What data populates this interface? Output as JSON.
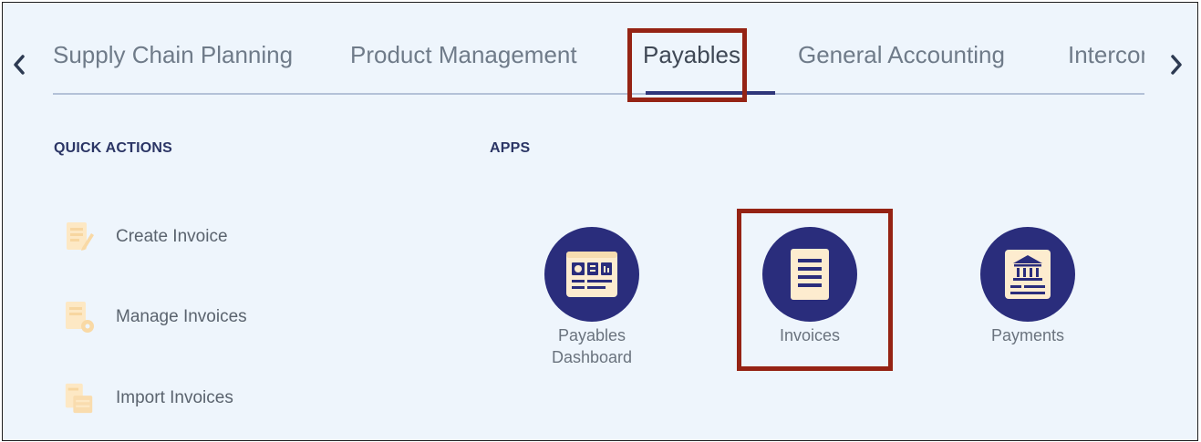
{
  "tabs": [
    {
      "label": "Supply Chain Planning",
      "active": false
    },
    {
      "label": "Product Management",
      "active": false
    },
    {
      "label": "Payables",
      "active": true
    },
    {
      "label": "General Accounting",
      "active": false
    },
    {
      "label": "Intercompany",
      "active": false
    }
  ],
  "nav": {
    "prev_icon": "chevron-left-icon",
    "next_icon": "chevron-right-icon"
  },
  "quick_actions": {
    "heading": "QUICK ACTIONS",
    "items": [
      {
        "label": "Create Invoice",
        "icon": "create-invoice-icon"
      },
      {
        "label": "Manage Invoices",
        "icon": "manage-invoices-icon"
      },
      {
        "label": "Import Invoices",
        "icon": "import-invoices-icon"
      }
    ]
  },
  "apps": {
    "heading": "APPS",
    "items": [
      {
        "label": "Payables\nDashboard",
        "icon": "dashboard-icon"
      },
      {
        "label": "Invoices",
        "icon": "invoice-document-icon"
      },
      {
        "label": "Payments",
        "icon": "bank-icon"
      }
    ]
  },
  "colors": {
    "background": "#eef5fc",
    "accent": "#2a2d7c",
    "icon_fill": "#fdeccf",
    "highlight_box": "#952314"
  }
}
